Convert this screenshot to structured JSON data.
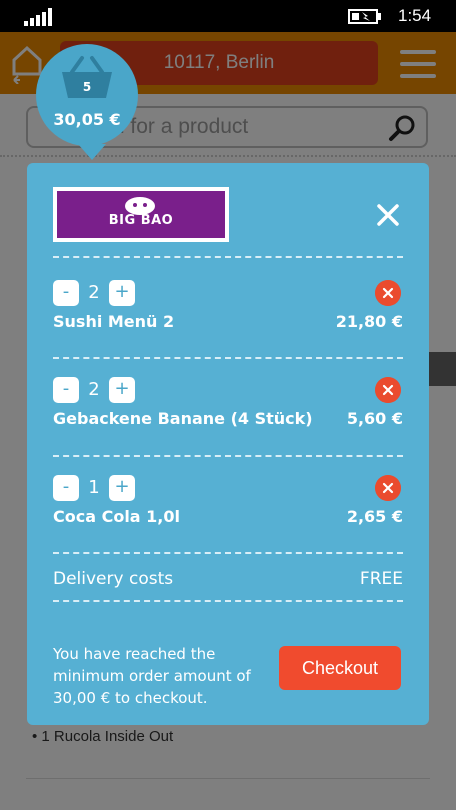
{
  "status_bar": {
    "time": "1:54",
    "signal_icon": "signal-bars-icon",
    "battery_icon": "battery-charging-icon"
  },
  "header": {
    "location": "10117, Berlin",
    "home_icon": "home-back-icon",
    "menu_icon": "hamburger-menu-icon"
  },
  "search": {
    "placeholder": "Search for a product",
    "icon": "search-icon"
  },
  "background": {
    "list_item": "• 1 Rucola Inside Out"
  },
  "basket_badge": {
    "count": "5",
    "total": "30,05 €",
    "icon": "basket-icon"
  },
  "basket": {
    "restaurant_logo_text": "BIG BAO",
    "close_icon": "close-icon",
    "items": [
      {
        "qty": "2",
        "name": "Sushi Menü 2",
        "price": "21,80 €"
      },
      {
        "qty": "2",
        "name": "Gebackene Banane (4 Stück)",
        "price": "5,60 €"
      },
      {
        "qty": "1",
        "name": "Coca Cola 1,0l",
        "price": "2,65 €"
      }
    ],
    "minus_label": "-",
    "plus_label": "+",
    "delivery_label": "Delivery costs",
    "delivery_value": "FREE",
    "notice": "You have reached the minimum order amount of 30,00 € to checkout.",
    "checkout_label": "Checkout"
  },
  "colors": {
    "header_orange": "#ed8b00",
    "location_red": "#e0401c",
    "panel_blue": "#56b0d3",
    "checkout_red": "#f04b2e",
    "logo_purple": "#7a1f8b"
  }
}
